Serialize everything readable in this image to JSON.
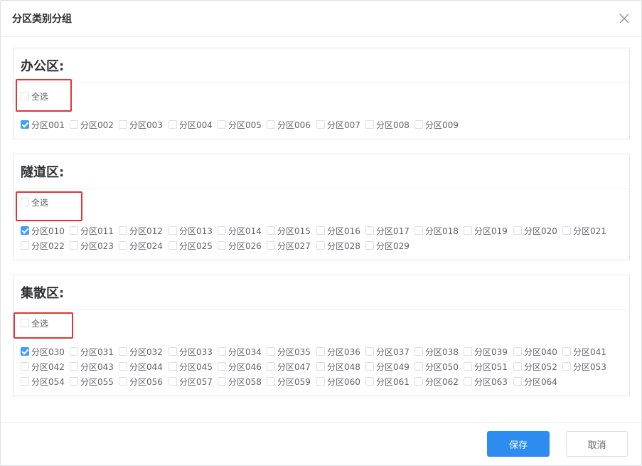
{
  "dialog": {
    "title": "分区类别分组",
    "close_icon": "close-icon",
    "save_label": "保存",
    "cancel_label": "取消"
  },
  "colors": {
    "accent": "#409eff",
    "highlight": "#e23434"
  },
  "groups": [
    {
      "title": "办公区:",
      "select_all": {
        "label": "全选",
        "checked": false
      },
      "items": [
        {
          "label": "分区001",
          "checked": true
        },
        {
          "label": "分区002",
          "checked": false
        },
        {
          "label": "分区003",
          "checked": false
        },
        {
          "label": "分区004",
          "checked": false
        },
        {
          "label": "分区005",
          "checked": false
        },
        {
          "label": "分区006",
          "checked": false
        },
        {
          "label": "分区007",
          "checked": false
        },
        {
          "label": "分区008",
          "checked": false
        },
        {
          "label": "分区009",
          "checked": false
        }
      ]
    },
    {
      "title": "隧道区:",
      "select_all": {
        "label": "全选",
        "checked": false
      },
      "items": [
        {
          "label": "分区010",
          "checked": true
        },
        {
          "label": "分区011",
          "checked": false
        },
        {
          "label": "分区012",
          "checked": false
        },
        {
          "label": "分区013",
          "checked": false
        },
        {
          "label": "分区014",
          "checked": false
        },
        {
          "label": "分区015",
          "checked": false
        },
        {
          "label": "分区016",
          "checked": false
        },
        {
          "label": "分区017",
          "checked": false
        },
        {
          "label": "分区018",
          "checked": false
        },
        {
          "label": "分区019",
          "checked": false
        },
        {
          "label": "分区020",
          "checked": false
        },
        {
          "label": "分区021",
          "checked": false
        },
        {
          "label": "分区022",
          "checked": false
        },
        {
          "label": "分区023",
          "checked": false
        },
        {
          "label": "分区024",
          "checked": false
        },
        {
          "label": "分区025",
          "checked": false
        },
        {
          "label": "分区026",
          "checked": false
        },
        {
          "label": "分区027",
          "checked": false
        },
        {
          "label": "分区028",
          "checked": false
        },
        {
          "label": "分区029",
          "checked": false
        }
      ]
    },
    {
      "title": "集散区:",
      "select_all": {
        "label": "全选",
        "checked": false
      },
      "items": [
        {
          "label": "分区030",
          "checked": true
        },
        {
          "label": "分区031",
          "checked": false
        },
        {
          "label": "分区032",
          "checked": false
        },
        {
          "label": "分区033",
          "checked": false
        },
        {
          "label": "分区034",
          "checked": false
        },
        {
          "label": "分区035",
          "checked": false
        },
        {
          "label": "分区036",
          "checked": false
        },
        {
          "label": "分区037",
          "checked": false
        },
        {
          "label": "分区038",
          "checked": false
        },
        {
          "label": "分区039",
          "checked": false
        },
        {
          "label": "分区040",
          "checked": false
        },
        {
          "label": "分区041",
          "checked": false
        },
        {
          "label": "分区042",
          "checked": false
        },
        {
          "label": "分区043",
          "checked": false
        },
        {
          "label": "分区044",
          "checked": false
        },
        {
          "label": "分区045",
          "checked": false
        },
        {
          "label": "分区046",
          "checked": false
        },
        {
          "label": "分区047",
          "checked": false
        },
        {
          "label": "分区048",
          "checked": false
        },
        {
          "label": "分区049",
          "checked": false
        },
        {
          "label": "分区050",
          "checked": false
        },
        {
          "label": "分区051",
          "checked": false
        },
        {
          "label": "分区052",
          "checked": false
        },
        {
          "label": "分区053",
          "checked": false
        },
        {
          "label": "分区054",
          "checked": false
        },
        {
          "label": "分区055",
          "checked": false
        },
        {
          "label": "分区056",
          "checked": false
        },
        {
          "label": "分区057",
          "checked": false
        },
        {
          "label": "分区058",
          "checked": false
        },
        {
          "label": "分区059",
          "checked": false
        },
        {
          "label": "分区060",
          "checked": false
        },
        {
          "label": "分区061",
          "checked": false
        },
        {
          "label": "分区062",
          "checked": false
        },
        {
          "label": "分区063",
          "checked": false
        },
        {
          "label": "分区064",
          "checked": false
        }
      ]
    }
  ]
}
